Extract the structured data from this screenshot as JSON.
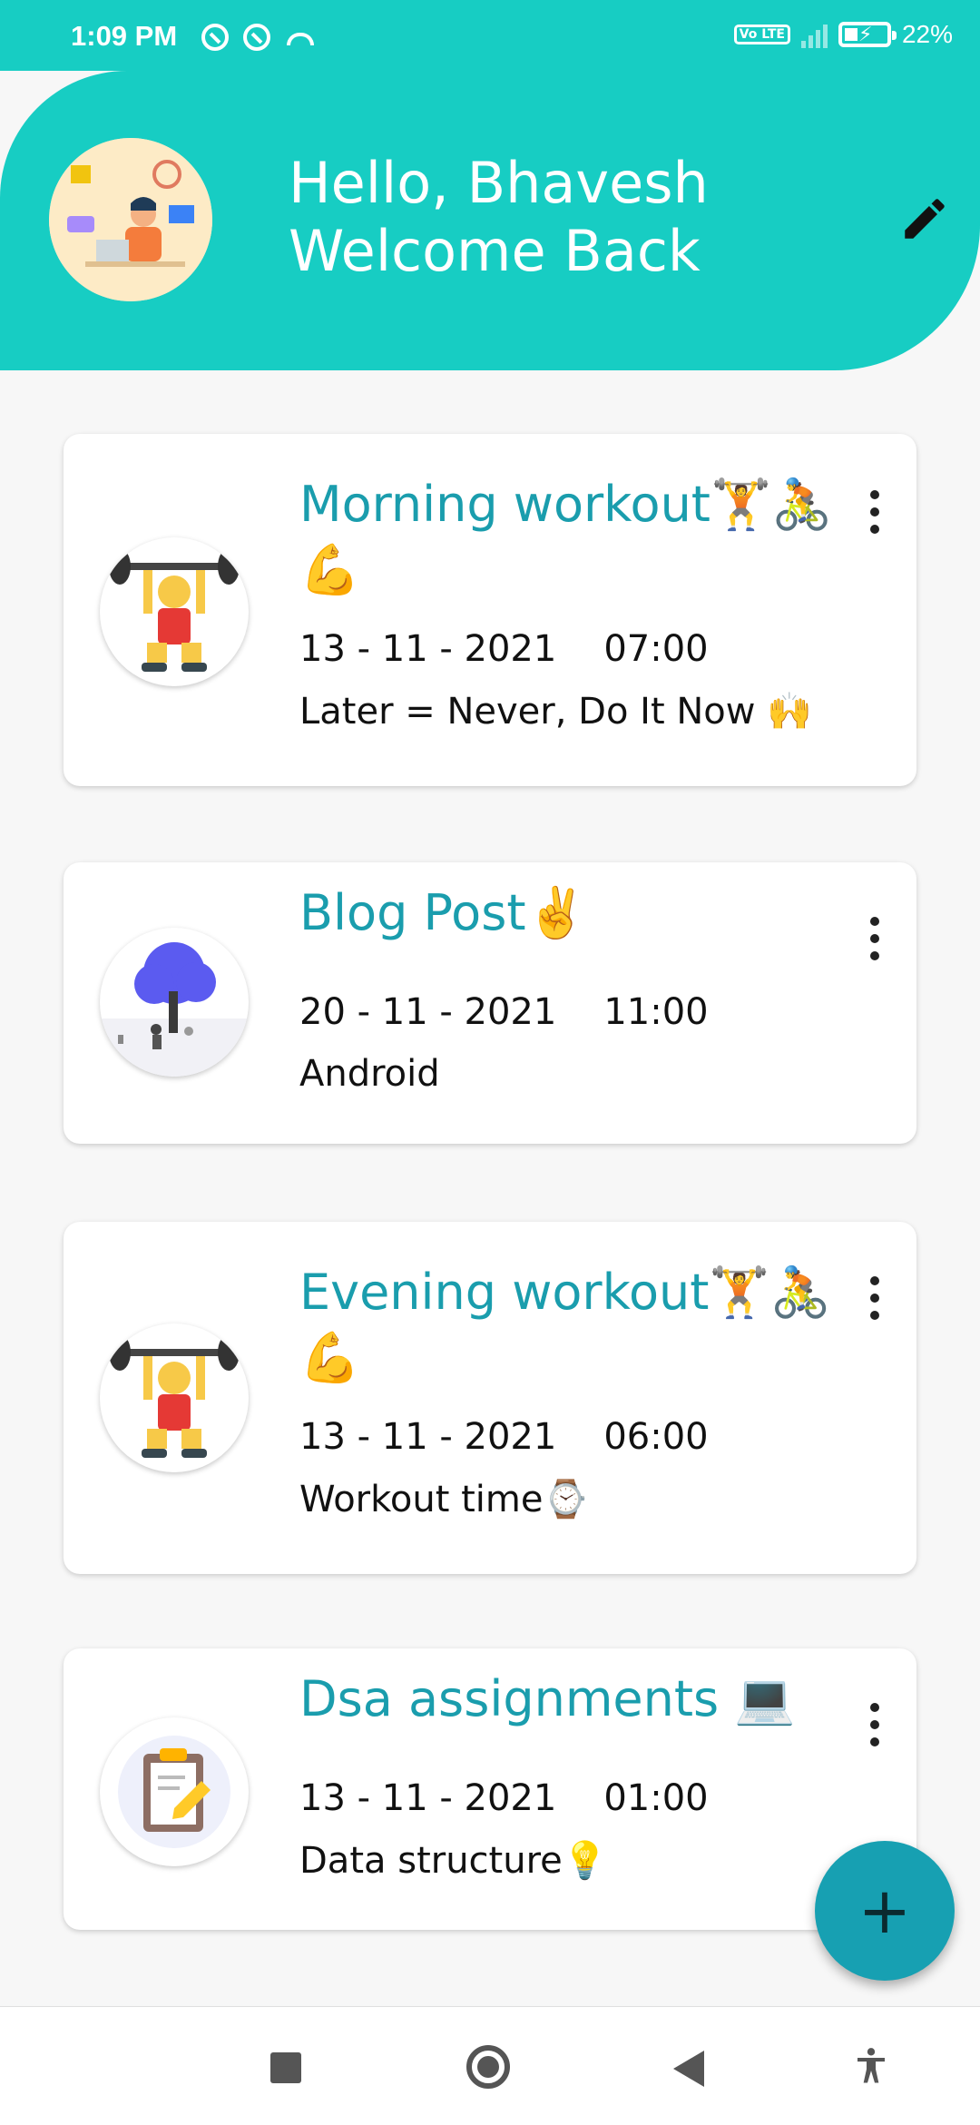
{
  "status_bar": {
    "time": "1:09 PM",
    "volte": "Vo LTE",
    "battery_percent": "22%",
    "battery_level": 0.22
  },
  "header": {
    "greeting": "Hello, Bhavesh",
    "subtitle": "Welcome Back",
    "accent_color": "#17cdc3",
    "edit_icon": "pencil-icon"
  },
  "tasks": [
    {
      "title": "Morning workout🏋️🚴💪",
      "date": "13 - 11 - 2021",
      "time": "07:00",
      "description": "Later = Never, Do It Now 🙌",
      "image": "weightlifter-icon"
    },
    {
      "title": "Blog Post✌️",
      "date": "20 - 11 - 2021",
      "time": "11:00",
      "description": "Android",
      "image": "tree-illustration-icon"
    },
    {
      "title": "Evening workout🏋️🚴💪",
      "date": "13 - 11 - 2021",
      "time": "06:00",
      "description": "Workout time⌚",
      "image": "weightlifter-icon"
    },
    {
      "title": "Dsa assignments 💻",
      "date": "13 - 11 - 2021",
      "time": "01:00",
      "description": "Data structure💡",
      "image": "clipboard-icon"
    }
  ],
  "fab": {
    "label": "+"
  },
  "title_color": "#1a9dad"
}
